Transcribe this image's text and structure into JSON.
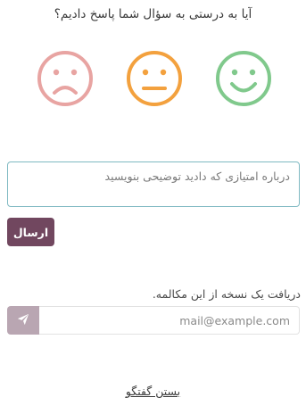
{
  "question": "آیا به درستی به سؤال شما پاسخ دادیم؟",
  "ratings": [
    {
      "name": "sad",
      "icon": "sad-face-icon",
      "color": "#e8a4a2"
    },
    {
      "name": "neutral",
      "icon": "neutral-face-icon",
      "color": "#f3a13e"
    },
    {
      "name": "happy",
      "icon": "happy-face-icon",
      "color": "#80c98c"
    }
  ],
  "feedback": {
    "placeholder": "درباره امتیازی که دادید توضیحی بنویسید",
    "value": ""
  },
  "send_button": {
    "label": "ارسال",
    "color": "#71475f"
  },
  "transcript": {
    "label": "دریافت یک نسخه از این مکالمه.",
    "email_placeholder": "mail@example.com",
    "send_icon": "paper-plane-icon",
    "button_color": "#b9a6b2"
  },
  "close_link": "بستن گفتگو"
}
